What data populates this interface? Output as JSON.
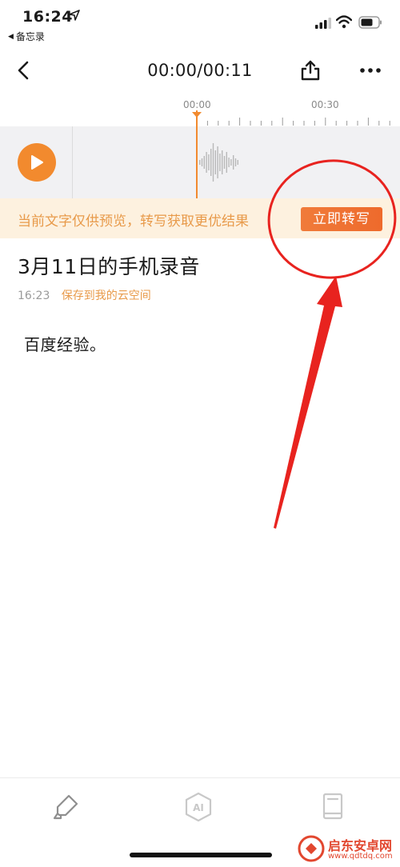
{
  "status_bar": {
    "time": "16:24",
    "back_app": "备忘录"
  },
  "nav": {
    "playback_time": "00:00/00:11"
  },
  "timeline": {
    "tick_labels": [
      "00:00",
      "00:30"
    ]
  },
  "banner": {
    "text": "当前文字仅供预览，转写获取更优结果",
    "button_label": "立即转写"
  },
  "recording": {
    "title": "3月11日的手机录音",
    "time": "16:23",
    "save_link": "保存到我的云空间",
    "body": "百度经验。"
  },
  "toolbar": {
    "items": [
      "highlighter-icon",
      "ai-icon",
      "notebook-icon"
    ]
  },
  "watermark": {
    "name": "启东安卓网",
    "url": "www.qdtdq.com"
  },
  "colors": {
    "accent": "#f28a2e",
    "banner_bg": "#fdf1df",
    "banner_text": "#e89a4a",
    "annotation": "#e8231f"
  }
}
